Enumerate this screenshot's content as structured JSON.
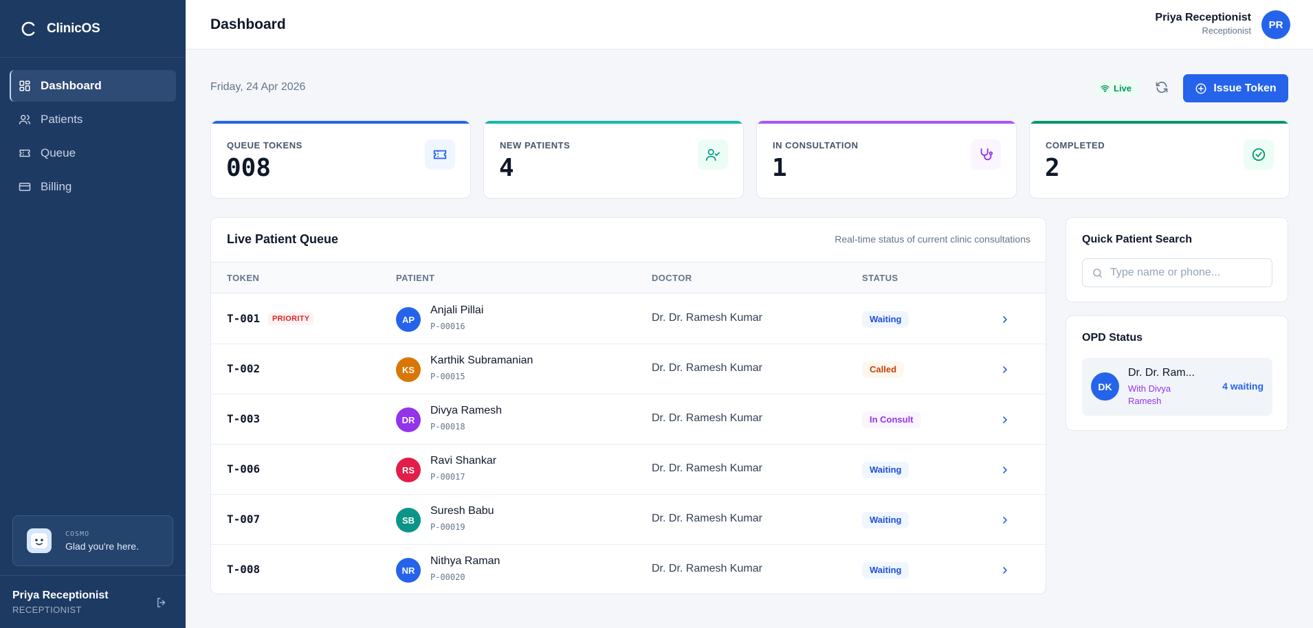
{
  "app": {
    "name": "ClinicOS"
  },
  "sidebar": {
    "items": [
      {
        "label": "Dashboard",
        "icon": "dashboard-icon",
        "active": true
      },
      {
        "label": "Patients",
        "icon": "users-icon"
      },
      {
        "label": "Queue",
        "icon": "ticket-icon"
      },
      {
        "label": "Billing",
        "icon": "card-icon"
      }
    ],
    "assistant": {
      "name": "COSMO",
      "message": "Glad you're here."
    },
    "user": {
      "name": "Priya Receptionist",
      "role": "RECEPTIONIST"
    }
  },
  "header": {
    "title": "Dashboard",
    "user": {
      "name": "Priya Receptionist",
      "role": "Receptionist",
      "initials": "PR"
    }
  },
  "toolbar": {
    "date": "Friday, 24 Apr 2026",
    "live_label": "Live",
    "issue_button": "Issue Token"
  },
  "stats": [
    {
      "label": "QUEUE TOKENS",
      "value": "008",
      "accent": "#2563eb"
    },
    {
      "label": "NEW PATIENTS",
      "value": "4",
      "accent": "#14b8a6"
    },
    {
      "label": "IN CONSULTATION",
      "value": "1",
      "accent": "#a855f7"
    },
    {
      "label": "COMPLETED",
      "value": "2",
      "accent": "#059669"
    }
  ],
  "queue": {
    "title": "Live Patient Queue",
    "subtitle": "Real-time status of current clinic consultations",
    "columns": [
      "TOKEN",
      "PATIENT",
      "DOCTOR",
      "STATUS"
    ],
    "rows": [
      {
        "token": "T-001",
        "priority": "PRIORITY",
        "initials": "AP",
        "color": "#2563eb",
        "name": "Anjali Pillai",
        "pid": "P-00016",
        "doctor": "Dr. Dr. Ramesh Kumar",
        "status": "Waiting"
      },
      {
        "token": "T-002",
        "priority": "",
        "initials": "KS",
        "color": "#d97706",
        "name": "Karthik Subramanian",
        "pid": "P-00015",
        "doctor": "Dr. Dr. Ramesh Kumar",
        "status": "Called"
      },
      {
        "token": "T-003",
        "priority": "",
        "initials": "DR",
        "color": "#9333ea",
        "name": "Divya Ramesh",
        "pid": "P-00018",
        "doctor": "Dr. Dr. Ramesh Kumar",
        "status": "In Consult"
      },
      {
        "token": "T-006",
        "priority": "",
        "initials": "RS",
        "color": "#e11d48",
        "name": "Ravi Shankar",
        "pid": "P-00017",
        "doctor": "Dr. Dr. Ramesh Kumar",
        "status": "Waiting"
      },
      {
        "token": "T-007",
        "priority": "",
        "initials": "SB",
        "color": "#0d9488",
        "name": "Suresh Babu",
        "pid": "P-00019",
        "doctor": "Dr. Dr. Ramesh Kumar",
        "status": "Waiting"
      },
      {
        "token": "T-008",
        "priority": "",
        "initials": "NR",
        "color": "#2563eb",
        "name": "Nithya Raman",
        "pid": "P-00020",
        "doctor": "Dr. Dr. Ramesh Kumar",
        "status": "Waiting"
      }
    ]
  },
  "search": {
    "title": "Quick Patient Search",
    "placeholder": "Type name or phone..."
  },
  "opd": {
    "title": "OPD Status",
    "doctors": [
      {
        "initials": "DK",
        "name": "Dr. Dr. Ram...",
        "with": "With Divya Ramesh",
        "waiting": "4 waiting"
      }
    ]
  }
}
